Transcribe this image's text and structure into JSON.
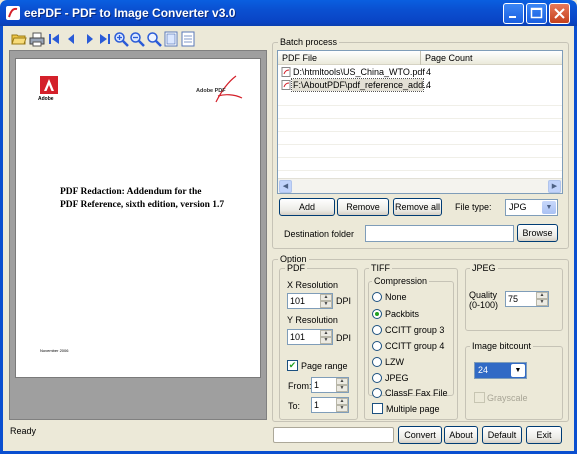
{
  "window": {
    "title": "eePDF - PDF to Image Converter v3.0"
  },
  "preview": {
    "brand_left": "Adobe",
    "brand_right": "Adobe PDF",
    "title_line1": "PDF Redaction: Addendum for the",
    "title_line2": "PDF Reference, sixth edition, version 1.7",
    "date": "November 2006"
  },
  "batch": {
    "group_label": "Batch process",
    "columns": [
      "PDF File",
      "Page Count"
    ],
    "rows": [
      {
        "file": "D:\\htmltools\\US_China_WTO.pdf",
        "count": "4"
      },
      {
        "file": "F:\\AboutPDF\\pdf_reference_add...",
        "count": "4"
      }
    ],
    "add_label": "Add",
    "remove_label": "Remove",
    "remove_all_label": "Remove all",
    "file_type_label": "File type:",
    "file_type_value": "JPG",
    "dest_label": "Destination folder",
    "dest_value": "",
    "browse_label": "Browse"
  },
  "option": {
    "group_label": "Option",
    "pdf": {
      "group_label": "PDF",
      "x_res_label": "X Resolution",
      "x_res_value": "101",
      "y_res_label": "Y Resolution",
      "y_res_value": "101",
      "dpi_label": "DPI",
      "page_range_label": "Page range",
      "page_range_checked": true,
      "from_label": "From:",
      "from_value": "1",
      "to_label": "To:",
      "to_value": "1"
    },
    "tiff": {
      "group_label": "TIFF",
      "compression_label": "Compression",
      "options": [
        "None",
        "Packbits",
        "CCITT group 3",
        "CCITT group 4",
        "LZW",
        "JPEG",
        "ClassF Fax File"
      ],
      "selected": "Packbits",
      "multipage_label": "Multiple page"
    },
    "jpeg": {
      "group_label": "JPEG",
      "quality_label": "Quality",
      "quality_range": "(0-100)",
      "quality_value": "75"
    },
    "bitcount": {
      "group_label": "Image bitcount",
      "value": "24",
      "grayscale_label": "Grayscale"
    }
  },
  "bottom": {
    "status": "Ready",
    "convert_label": "Convert",
    "about_label": "About",
    "default_label": "Default",
    "exit_label": "Exit"
  },
  "colors": {
    "titlebar": "#0a4fd0",
    "face": "#ece9d8",
    "radio_dot": "#21a121"
  }
}
